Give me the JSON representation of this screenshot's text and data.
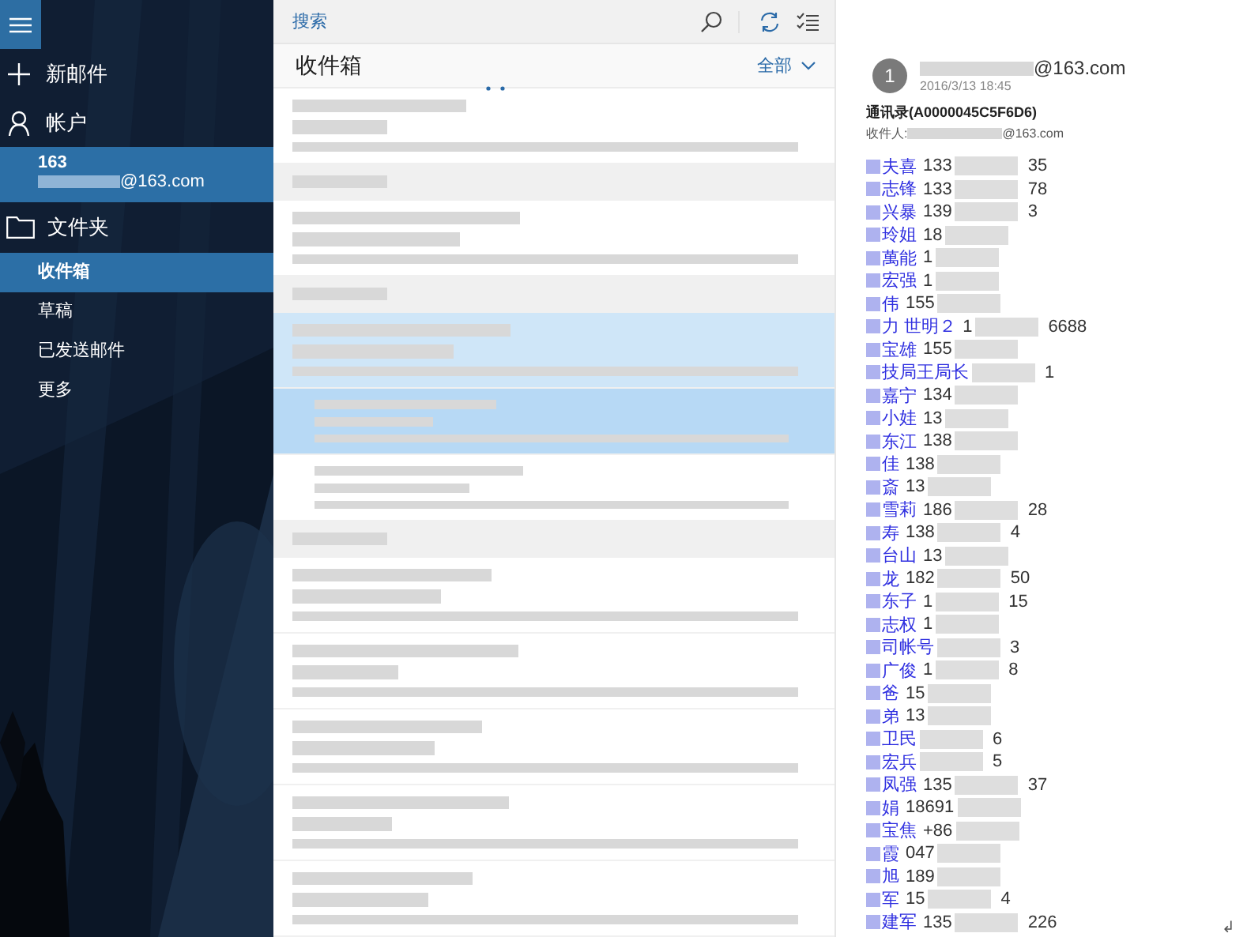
{
  "sidebar": {
    "actions": [
      {
        "kind": "new",
        "label": "新邮件"
      },
      {
        "kind": "account",
        "label": "帐户"
      }
    ],
    "account": {
      "name": "163",
      "email_suffix": "@163.com",
      "selected": true
    },
    "folders_label": "文件夹",
    "folders": [
      {
        "label": "收件箱",
        "selected": true
      },
      {
        "label": "草稿",
        "selected": false
      },
      {
        "label": "已发送邮件",
        "selected": false
      },
      {
        "label": "更多",
        "selected": false
      }
    ]
  },
  "list": {
    "search_placeholder": "搜索",
    "title": "收件箱",
    "filter": "全部",
    "items": [
      {
        "kind": "message",
        "selected": false
      },
      {
        "kind": "header",
        "selected": false
      },
      {
        "kind": "message",
        "selected": false
      },
      {
        "kind": "header",
        "selected": false
      },
      {
        "kind": "message",
        "selected": true
      },
      {
        "kind": "child",
        "selected": true
      },
      {
        "kind": "child",
        "selected": false
      },
      {
        "kind": "header",
        "selected": false
      },
      {
        "kind": "message",
        "selected": false
      },
      {
        "kind": "message",
        "selected": false
      },
      {
        "kind": "message",
        "selected": false
      },
      {
        "kind": "message",
        "selected": false
      },
      {
        "kind": "message",
        "selected": false
      }
    ]
  },
  "reading": {
    "avatar": "1",
    "sender_suffix": "@163.com",
    "date": "2016/3/13 18:45",
    "subject": "通讯录(A0000045C5F6D6)",
    "to_label": "收件人:",
    "to_suffix": "@163.com",
    "contacts": [
      {
        "name": "夫喜",
        "head": "133",
        "tail": "35"
      },
      {
        "name": "志锋",
        "head": "133",
        "tail": "78"
      },
      {
        "name": "兴暴",
        "head": "139",
        "tail": "3"
      },
      {
        "name": "玲姐",
        "head": "18"
      },
      {
        "name": "萬能",
        "head": "1"
      },
      {
        "name": "宏强",
        "head": "1"
      },
      {
        "name": "伟",
        "head": "155"
      },
      {
        "name": "力 世明２",
        "head": "1",
        "tail": "6688"
      },
      {
        "name": "宝雄",
        "head": "155"
      },
      {
        "name": "技局王局长",
        "tail": "1"
      },
      {
        "name": "嘉宁",
        "head": "134"
      },
      {
        "name": "小娃",
        "head": "13"
      },
      {
        "name": "东江",
        "head": "138"
      },
      {
        "name": "佳",
        "head": "138"
      },
      {
        "name": "斎",
        "head": "13"
      },
      {
        "name": "雪莉",
        "head": "186",
        "tail": "28"
      },
      {
        "name": "寿",
        "head": "138",
        "tail": "4"
      },
      {
        "name": "台山",
        "head": "13"
      },
      {
        "name": "龙",
        "head": "182",
        "tail": "50"
      },
      {
        "name": "东子",
        "head": "1",
        "tail": "15"
      },
      {
        "name": "志权",
        "head": "1"
      },
      {
        "name": "司帐号",
        "tail": "3"
      },
      {
        "name": "广俊",
        "head": "1",
        "tail": "8"
      },
      {
        "name": "爸",
        "head": "15"
      },
      {
        "name": "弟",
        "head": "13"
      },
      {
        "name": "卫民",
        "tail": "6"
      },
      {
        "name": "宏兵",
        "tail": "5"
      },
      {
        "name": "凤强",
        "head": "135",
        "tail": "37"
      },
      {
        "name": "娟",
        "head": "18691"
      },
      {
        "name": "宝焦",
        "head": "+86"
      },
      {
        "name": "霞",
        "head": "047"
      },
      {
        "name": "旭",
        "head": "189"
      },
      {
        "name": "军",
        "head": "15",
        "tail": "4"
      },
      {
        "name": "建军",
        "head": "135",
        "tail": "226"
      }
    ],
    "end_mark": "↲"
  }
}
